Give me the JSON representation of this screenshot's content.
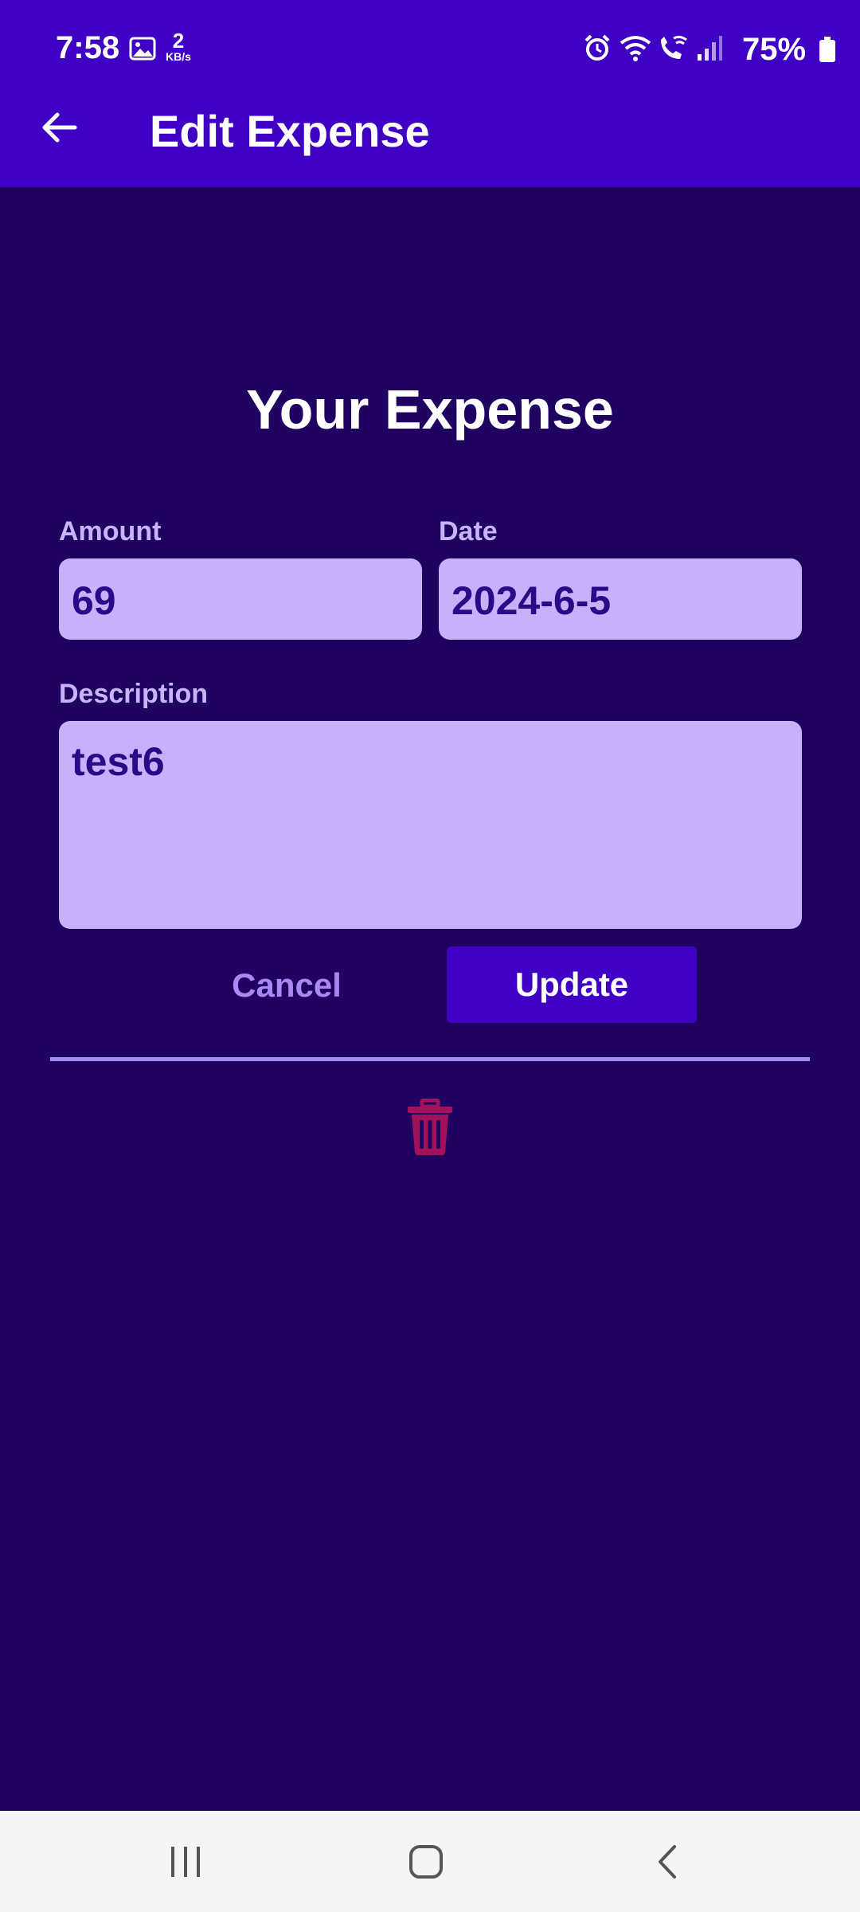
{
  "status_bar": {
    "time": "7:58",
    "net_speed_value": "2",
    "net_speed_unit": "KB/s",
    "battery": "75%",
    "icons": [
      "gallery-icon",
      "alarm-icon",
      "wifi-icon",
      "wifi-calling-icon",
      "signal-icon",
      "battery-icon"
    ]
  },
  "app_bar": {
    "title": "Edit Expense",
    "back_icon": "arrow-left-icon"
  },
  "form": {
    "heading": "Your Expense",
    "amount_label": "Amount",
    "amount_value": "69",
    "date_label": "Date",
    "date_value": "2024-6-5",
    "description_label": "Description",
    "description_value": "test6"
  },
  "actions": {
    "cancel_label": "Cancel",
    "update_label": "Update",
    "delete_icon": "trash-icon"
  },
  "nav_bar": {
    "icons": [
      "recent-apps-icon",
      "home-icon",
      "back-icon"
    ]
  },
  "colors": {
    "app_bar": "#3f01c4",
    "background": "#200360",
    "input_fill": "#c7b1fb",
    "input_text": "#2a0a86",
    "label": "#c8b4fb",
    "cancel_text": "#a989f2",
    "delete_icon": "#a1125a"
  }
}
